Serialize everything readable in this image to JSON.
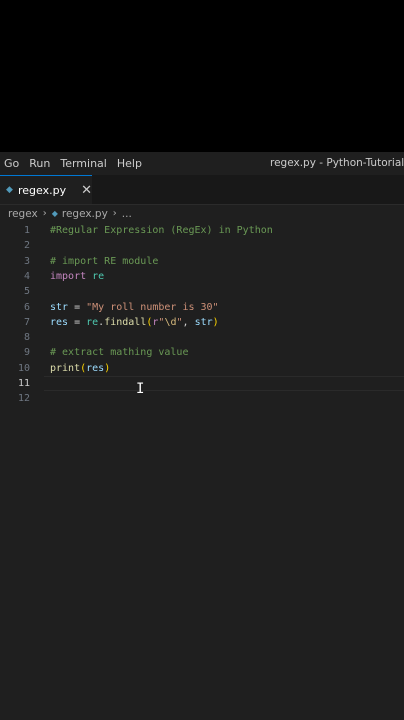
{
  "menubar": {
    "items": [
      "Go",
      "Run",
      "Terminal",
      "Help"
    ],
    "window_title": "regex.py - Python-Tutorial - Vis"
  },
  "tab": {
    "label": "regex.py",
    "close": "✕",
    "icon": "python-file-icon"
  },
  "breadcrumb": {
    "root": "regex",
    "file": "regex.py",
    "more": "..."
  },
  "editor": {
    "active_line": 11,
    "lines": [
      {
        "n": "1",
        "tokens": [
          [
            "c-comment",
            "#Regular Expression (RegEx) in Python"
          ]
        ]
      },
      {
        "n": "2",
        "tokens": []
      },
      {
        "n": "3",
        "tokens": [
          [
            "c-comment",
            "# import RE module"
          ]
        ]
      },
      {
        "n": "4",
        "tokens": [
          [
            "c-kw",
            "import"
          ],
          [
            "c-op",
            " "
          ],
          [
            "c-mod",
            "re"
          ]
        ]
      },
      {
        "n": "5",
        "tokens": []
      },
      {
        "n": "6",
        "tokens": [
          [
            "c-var",
            "str"
          ],
          [
            "c-op",
            " = "
          ],
          [
            "c-str",
            "\"My roll number is 30\""
          ]
        ]
      },
      {
        "n": "7",
        "tokens": [
          [
            "c-var",
            "res"
          ],
          [
            "c-op",
            " = "
          ],
          [
            "c-mod",
            "re"
          ],
          [
            "c-op",
            "."
          ],
          [
            "c-fn",
            "findall"
          ],
          [
            "c-br1",
            "("
          ],
          [
            "c-kw",
            "r"
          ],
          [
            "c-str",
            "\""
          ],
          [
            "c-esc",
            "\\d"
          ],
          [
            "c-str",
            "\""
          ],
          [
            "c-op",
            ", "
          ],
          [
            "c-var",
            "str"
          ],
          [
            "c-br1",
            ")"
          ]
        ]
      },
      {
        "n": "8",
        "tokens": []
      },
      {
        "n": "9",
        "tokens": [
          [
            "c-comment",
            "# extract mathing value"
          ]
        ]
      },
      {
        "n": "10",
        "tokens": [
          [
            "c-fn",
            "print"
          ],
          [
            "c-br1",
            "("
          ],
          [
            "c-var",
            "res"
          ],
          [
            "c-br1",
            ")"
          ]
        ]
      },
      {
        "n": "11",
        "tokens": []
      },
      {
        "n": "12",
        "tokens": []
      }
    ]
  },
  "colors": {
    "background": "#1f1f1f",
    "comment": "#6a9955",
    "keyword": "#c586c0",
    "string": "#ce9178",
    "function": "#dcdcaa",
    "variable": "#9cdcfe",
    "accent": "#0078d4"
  }
}
